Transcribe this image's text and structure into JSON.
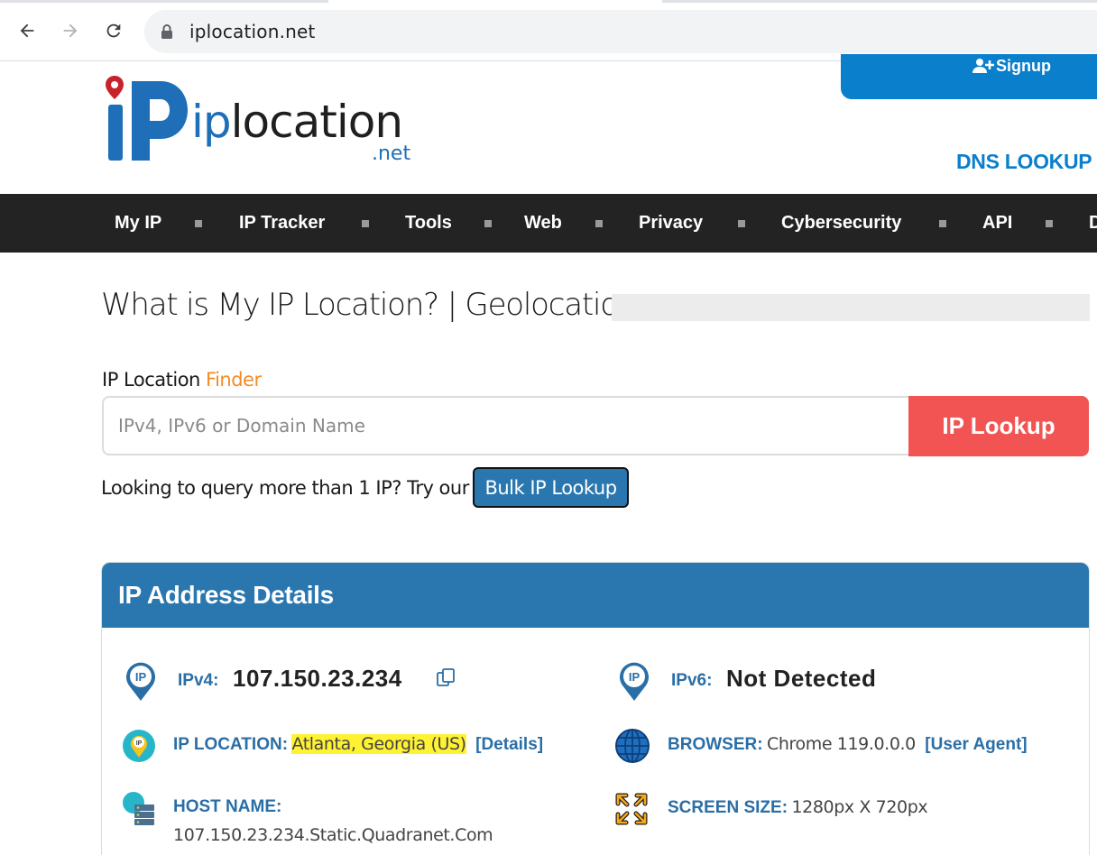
{
  "browser": {
    "url": "iplocation.net",
    "icons": [
      "back-arrow-icon",
      "forward-arrow-icon",
      "reload-icon",
      "lock-icon"
    ]
  },
  "header": {
    "logo_text": "iplocation",
    "logo_tld": ".net",
    "signup_label": "Signup",
    "dns_lookup_label": "DNS LOOKUP"
  },
  "nav": {
    "items": [
      "My IP",
      "IP Tracker",
      "Tools",
      "Web",
      "Privacy",
      "Cybersecurity",
      "API",
      "D"
    ]
  },
  "main": {
    "title": "What is My IP Location? | Geolocation",
    "finder": {
      "label": "IP Location ",
      "label_accent": "Finder",
      "placeholder": "IPv4, IPv6 or Domain Name",
      "button": "IP Lookup"
    },
    "bulk": {
      "text": "Looking to query more than 1 IP? Try our",
      "button": "Bulk IP Lookup"
    },
    "details": {
      "title": "IP Address Details",
      "ipv4_label": "IPv4:",
      "ipv4_value": "107.150.23.234",
      "ipv6_label": "IPv6:",
      "ipv6_value": "Not Detected",
      "location_label": "IP LOCATION:",
      "location_value": "Atlanta, Georgia (US)",
      "location_link": "[Details]",
      "browser_label": "BROWSER:",
      "browser_value": "Chrome 119.0.0.0",
      "browser_link": "[User Agent]",
      "host_label": "HOST NAME:",
      "host_value": "107.150.23.234.Static.Quadranet.Com",
      "screen_label": "SCREEN SIZE:",
      "screen_value": "1280px X 720px"
    }
  },
  "colors": {
    "brand_blue": "#2a77b0",
    "lookup_red": "#f25454",
    "finder_orange": "#f58b24",
    "navbar": "#232323",
    "highlight": "#fff233"
  }
}
